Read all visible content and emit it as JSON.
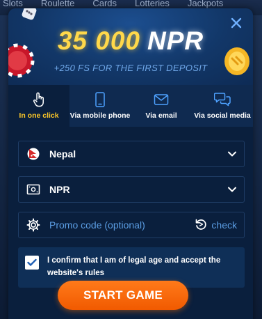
{
  "background": {
    "nav": [
      "Slots",
      "Roulette",
      "Cards",
      "Lotteries",
      "Jackpots"
    ]
  },
  "modal": {
    "bonus_amount": "35 000",
    "bonus_currency": "NPR",
    "bonus_subtitle": "+250 FS FOR THE FIRST DEPOSIT",
    "close_icon": "close-icon"
  },
  "tabs": [
    {
      "label": "In one click",
      "icon": "tap-icon",
      "active": true
    },
    {
      "label": "Via mobile phone",
      "icon": "phone-icon",
      "active": false
    },
    {
      "label": "Via email",
      "icon": "envelope-icon",
      "active": false
    },
    {
      "label": "Via social media",
      "icon": "chat-icon",
      "active": false
    }
  ],
  "form": {
    "country": {
      "value": "Nepal",
      "icon": "nepal-flag-icon"
    },
    "currency": {
      "value": "NPR",
      "icon": "banknote-icon"
    },
    "promo": {
      "placeholder": "Promo code (optional)",
      "check_label": "check",
      "icon": "gear-icon"
    },
    "consent": {
      "text": "I confirm that I am of legal age and accept the website's rules",
      "checked": true
    }
  },
  "start_button": "START GAME",
  "colors": {
    "accent_yellow": "#ffc928",
    "start_orange": "#ff6a00",
    "link_blue": "#5b9de3"
  }
}
